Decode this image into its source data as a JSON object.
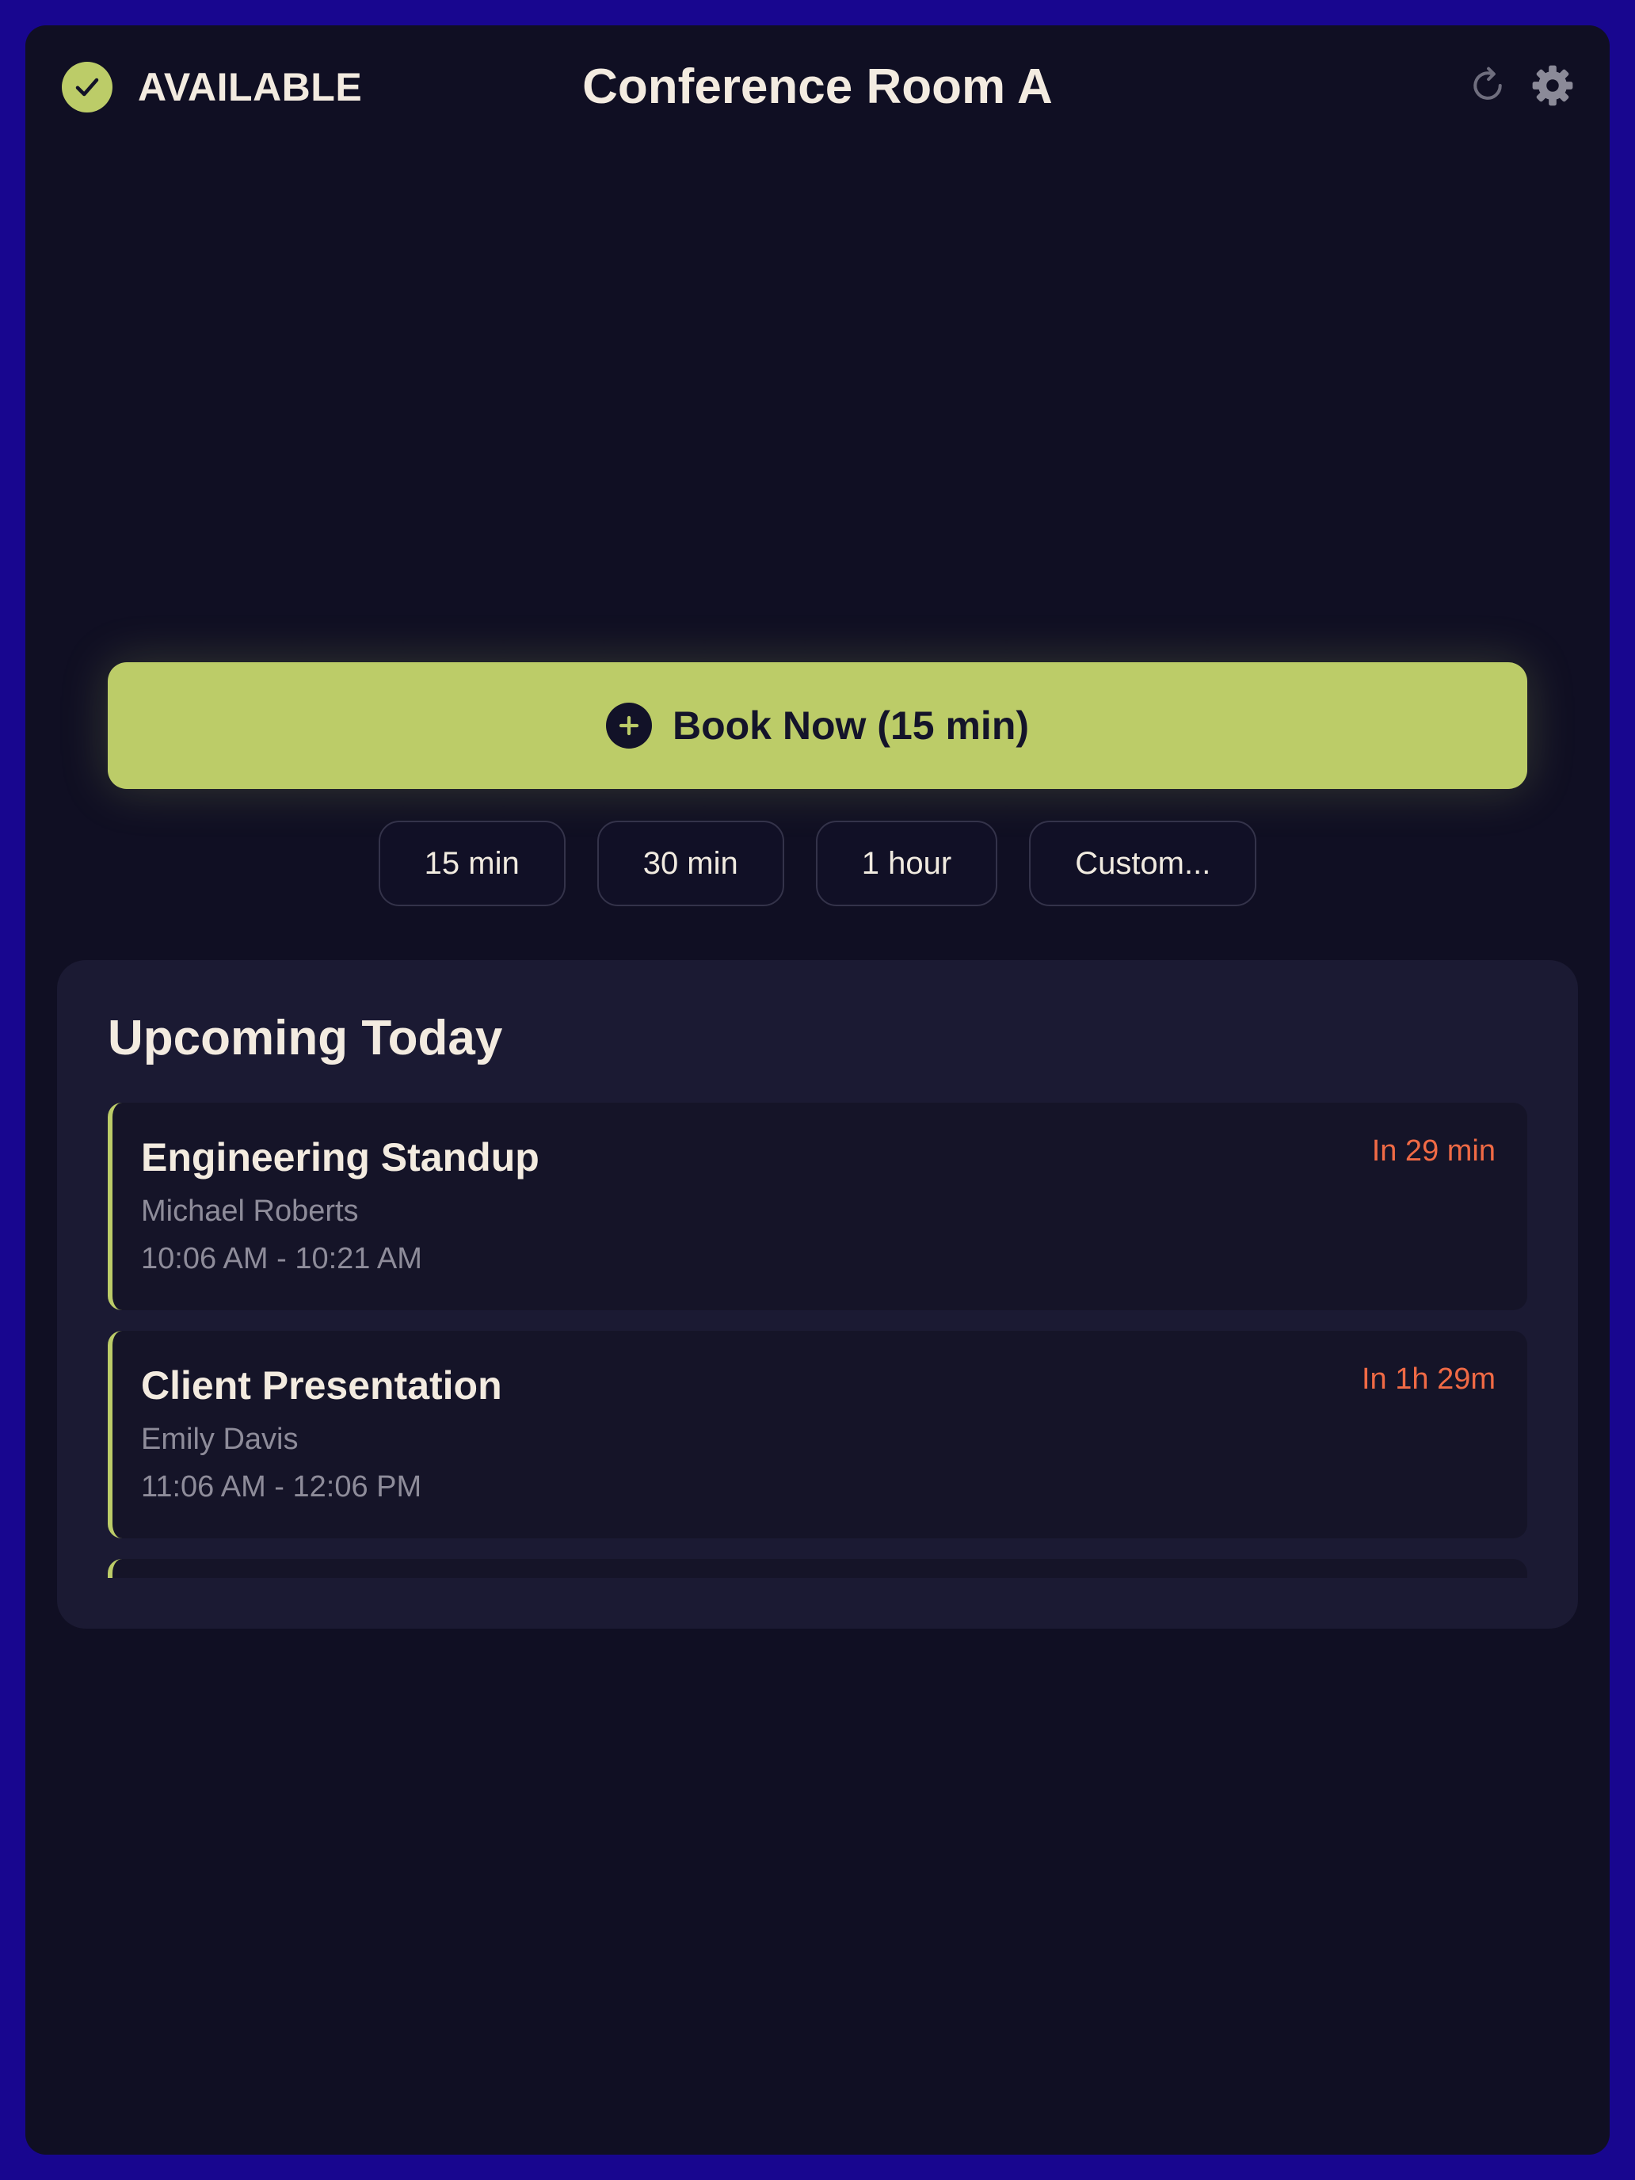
{
  "header": {
    "status_label": "AVAILABLE",
    "room_name": "Conference Room A",
    "status_icon": "checkmark-icon",
    "refresh_icon": "refresh-icon",
    "settings_icon": "gear-icon"
  },
  "booking": {
    "book_now_label": "Book Now (15 min)",
    "book_now_icon": "plus-icon",
    "durations": [
      "15 min",
      "30 min",
      "1 hour",
      "Custom..."
    ]
  },
  "upcoming": {
    "title": "Upcoming Today",
    "events": [
      {
        "title": "Engineering Standup",
        "organizer": "Michael Roberts",
        "time": "10:06 AM - 10:21 AM",
        "countdown": "In 29 min"
      },
      {
        "title": "Client Presentation",
        "organizer": "Emily Davis",
        "time": "11:06 AM - 12:06 PM",
        "countdown": "In 1h 29m"
      }
    ]
  },
  "colors": {
    "accent": "#bccc68",
    "background": "#100f23",
    "outer_border": "#18068f",
    "panel": "#1b1a33",
    "countdown": "#f06a45"
  }
}
